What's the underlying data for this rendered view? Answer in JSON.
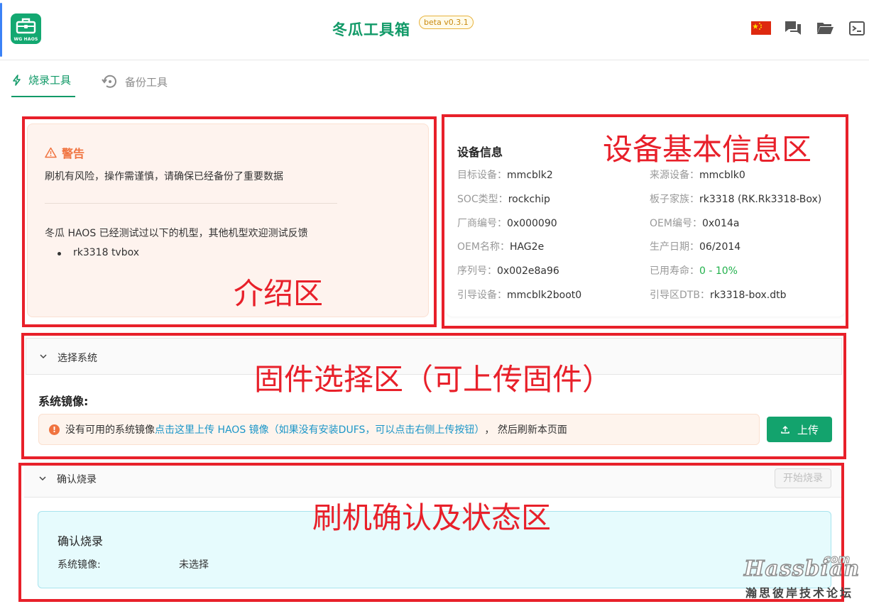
{
  "header": {
    "logo_text": "WG HAOS",
    "title": "冬瓜工具箱",
    "version": "beta v0.3.1",
    "icons": [
      "china-flag-icon",
      "chat-icon",
      "folder-icon",
      "terminal-icon"
    ]
  },
  "tabs": [
    {
      "label": "烧录工具",
      "icon": "lightning-icon",
      "active": true
    },
    {
      "label": "备份工具",
      "icon": "backup-icon",
      "active": false
    }
  ],
  "warning": {
    "title": "警告",
    "text": "刷机有风险，操作需谨慎，请确保已经备份了重要数据",
    "tested_text": "冬瓜 HAOS 已经测试过以下的机型，其他机型欢迎测试反馈",
    "tested_models": [
      "rk3318 tvbox"
    ]
  },
  "device": {
    "title": "设备信息",
    "rows": [
      {
        "label": "目标设备：",
        "value": "mmcblk2"
      },
      {
        "label": "来源设备：",
        "value": "mmcblk0"
      },
      {
        "label": "SOC类型：",
        "value": "rockchip"
      },
      {
        "label": "板子家族：",
        "value": "rk3318 (RK.Rk3318-Box)"
      },
      {
        "label": "厂商编号：",
        "value": "0x000090"
      },
      {
        "label": "OEM编号：",
        "value": "0x014a"
      },
      {
        "label": "OEM名称：",
        "value": "HAG2e\u0007"
      },
      {
        "label": "生产日期：",
        "value": "06/2014"
      },
      {
        "label": "序列号：",
        "value": "0x002e8a96"
      },
      {
        "label": "已用寿命：",
        "value": "0 - 10%"
      },
      {
        "label": "引导设备：",
        "value": "mmcblk2boot0"
      },
      {
        "label": "引导区DTB：",
        "value": "rk3318-box.dtb"
      }
    ],
    "lifetime_color": "#22b14c"
  },
  "firmware": {
    "section_label": "选择系统",
    "subtitle": "系统镜像:",
    "alert_prefix": "没有可用的系统镜像 ",
    "alert_link": "点击这里上传 HAOS 镜像（如果没有安装DUFS，可以点击右侧上传按钮）",
    "alert_suffix": "， 然后刷新本页面",
    "upload_label": "上传"
  },
  "confirm": {
    "section_label": "确认烧录",
    "start_button": "开始烧录",
    "card_title": "确认烧录",
    "image_label": "系统镜像:",
    "image_value": "未选择"
  },
  "annotations": {
    "intro": "介绍区",
    "device": "设备基本信息区",
    "firmware": "固件选择区（可上传固件）",
    "confirm": "刷机确认及状态区"
  },
  "watermark": {
    "main": "Hassbian",
    "com": "com",
    "sub": "瀚思彼岸技术论坛"
  },
  "colors": {
    "brand_green": "#129a68",
    "warning_orange": "#f0733f",
    "link_blue": "#1c96c8",
    "annotation_red": "#e8202a"
  }
}
